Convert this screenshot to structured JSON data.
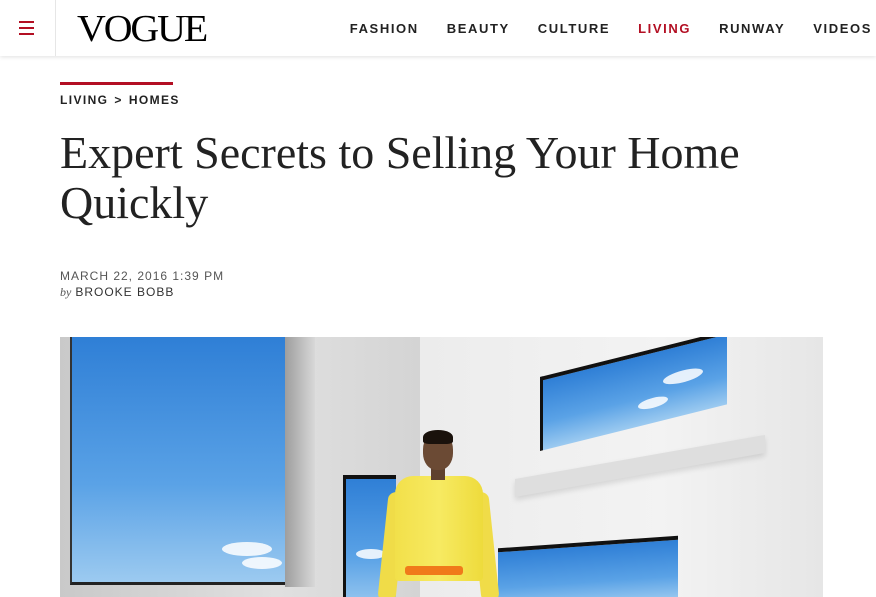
{
  "header": {
    "menu_icon": "hamburger-menu-icon",
    "logo": "VOGUE",
    "nav": [
      {
        "label": "FASHION",
        "active": false
      },
      {
        "label": "BEAUTY",
        "active": false
      },
      {
        "label": "CULTURE",
        "active": false
      },
      {
        "label": "LIVING",
        "active": true
      },
      {
        "label": "RUNWAY",
        "active": false
      },
      {
        "label": "VIDEOS",
        "active": false
      }
    ]
  },
  "article": {
    "breadcrumb": {
      "section": "LIVING",
      "separator": ">",
      "subsection": "HOMES"
    },
    "title": "Expert Secrets to Selling Your Home Quickly",
    "date": "MARCH 22, 2016 1:39 PM",
    "byline_prefix": "by",
    "author": "BROOKE BOBB",
    "hero_image": "woman-in-yellow-shirt-modern-white-room-photo"
  },
  "colors": {
    "accent": "#b30f23",
    "text": "#222222",
    "background": "#ffffff"
  }
}
